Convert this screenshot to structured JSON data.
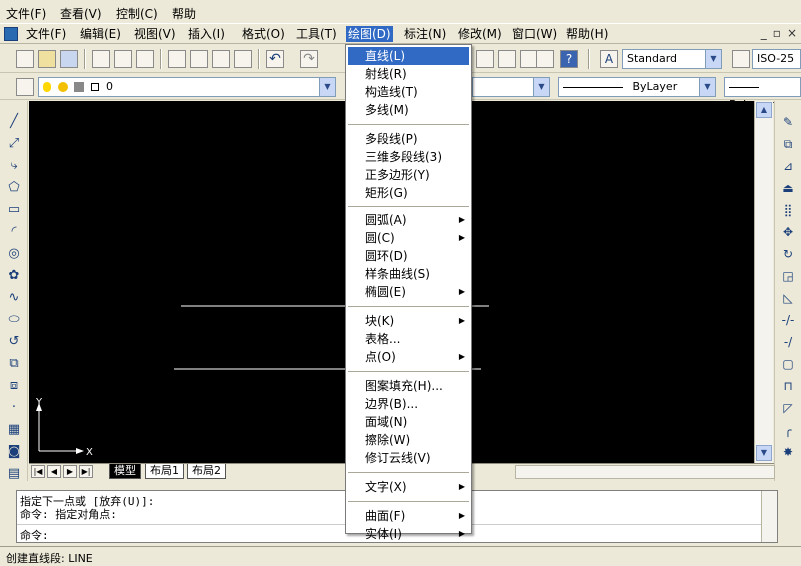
{
  "outer_menu": [
    "文件(F)",
    "查看(V)",
    "控制(C)",
    "帮助"
  ],
  "app_menu": {
    "items": [
      "文件(F)",
      "编辑(E)",
      "视图(V)",
      "插入(I)",
      "格式(O)",
      "工具(T)",
      "绘图(D)",
      "标注(N)",
      "修改(M)",
      "窗口(W)",
      "帮助(H)"
    ],
    "active": "绘图(D)"
  },
  "window_controls": [
    "_",
    "▫",
    "×"
  ],
  "toolbar": {
    "text_style": "Standard",
    "dim_style": "ISO-25",
    "layer": "0",
    "linetype": "ByLayer",
    "lineweight": "ByLayer"
  },
  "draw_menu": {
    "groups": [
      [
        {
          "label": "直线(L)",
          "highlight": true
        },
        {
          "label": "射线(R)"
        },
        {
          "label": "构造线(T)"
        },
        {
          "label": "多线(M)"
        }
      ],
      [
        {
          "label": "多段线(P)"
        },
        {
          "label": "三维多段线(3)"
        },
        {
          "label": "正多边形(Y)"
        },
        {
          "label": "矩形(G)"
        }
      ],
      [
        {
          "label": "圆弧(A)",
          "submenu": true
        },
        {
          "label": "圆(C)",
          "submenu": true
        },
        {
          "label": "圆环(D)"
        },
        {
          "label": "样条曲线(S)"
        },
        {
          "label": "椭圆(E)",
          "submenu": true
        }
      ],
      [
        {
          "label": "块(K)",
          "submenu": true
        },
        {
          "label": "表格..."
        },
        {
          "label": "点(O)",
          "submenu": true
        }
      ],
      [
        {
          "label": "图案填充(H)..."
        },
        {
          "label": "边界(B)..."
        },
        {
          "label": "面域(N)"
        },
        {
          "label": "擦除(W)"
        },
        {
          "label": "修订云线(V)"
        }
      ],
      [
        {
          "label": "文字(X)",
          "submenu": true
        }
      ],
      [
        {
          "label": "曲面(F)",
          "submenu": true
        },
        {
          "label": "实体(I)",
          "submenu": true
        }
      ]
    ]
  },
  "layout_tabs": [
    "模型",
    "布局1",
    "布局2"
  ],
  "ucs": {
    "y": "Y",
    "x": "X"
  },
  "command_window": {
    "lines": [
      "指定下一点或 [放弃(U)]:",
      "命令: 指定对角点:"
    ],
    "prompt": "命令:"
  },
  "status_bar": {
    "text": "创建直线段:  LINE"
  },
  "colors": {
    "menu_bg": "#ece9d8",
    "highlight": "#316ac5",
    "canvas": "#000000"
  }
}
